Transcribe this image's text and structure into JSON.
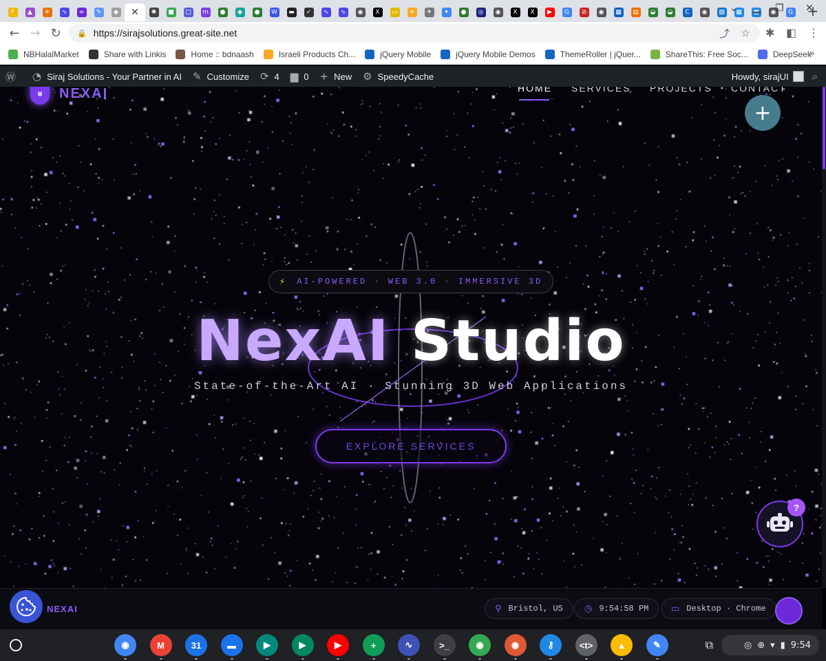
{
  "browser": {
    "url": "https://sirajsolutions.great-site.net",
    "tabs": [
      {
        "icon": "f-icon",
        "color": "#f4b400",
        "glyph": "F"
      },
      {
        "icon": "triangle-icon",
        "color": "#9c4dcc",
        "glyph": "▲"
      },
      {
        "icon": "asterisk-icon",
        "color": "#e8710a",
        "glyph": "✳"
      },
      {
        "icon": "wave-icon",
        "color": "#4f46e5",
        "glyph": "∿"
      },
      {
        "icon": "infinity-icon",
        "color": "#6d28d9",
        "glyph": "∞"
      },
      {
        "icon": "feather-icon",
        "color": "#5e97f6",
        "glyph": "✎"
      },
      {
        "icon": "cat-icon",
        "color": "#9e9e9e",
        "glyph": "◆"
      },
      {
        "icon": "openai-icon",
        "color": "#444",
        "glyph": "✺"
      },
      {
        "icon": "green-icon",
        "color": "#34a853",
        "glyph": "■"
      },
      {
        "icon": "square-icon",
        "color": "#5b5bd6",
        "glyph": "□"
      },
      {
        "icon": "m-icon",
        "color": "#7b3fe4",
        "glyph": "m"
      },
      {
        "icon": "circle-green-icon",
        "color": "#2e7d32",
        "glyph": "●"
      },
      {
        "icon": "diamond-icon",
        "color": "#1aa39a",
        "glyph": "◆"
      },
      {
        "icon": "circle-icon",
        "color": "#2e7d32",
        "glyph": "●"
      },
      {
        "icon": "wordpress-icon",
        "color": "#3858e9",
        "glyph": "W"
      },
      {
        "icon": "bar-icon",
        "color": "#222",
        "glyph": "▬"
      },
      {
        "icon": "check-icon",
        "color": "#333",
        "glyph": "✓"
      },
      {
        "icon": "wave2-icon",
        "color": "#4f46e5",
        "glyph": "∿"
      },
      {
        "icon": "wave3-icon",
        "color": "#4f46e5",
        "glyph": "∿"
      },
      {
        "icon": "globe-icon",
        "color": "#555",
        "glyph": "◉"
      },
      {
        "icon": "x-icon",
        "color": "#000",
        "glyph": "X"
      },
      {
        "icon": "doc-icon",
        "color": "#e6b800",
        "glyph": "▭"
      },
      {
        "icon": "sun-icon",
        "color": "#f9a825",
        "glyph": "☀"
      },
      {
        "icon": "bird-icon",
        "color": "#777",
        "glyph": "✈"
      },
      {
        "icon": "gemini-icon",
        "color": "#4285f4",
        "glyph": "✦"
      },
      {
        "icon": "circle-green2-icon",
        "color": "#2e7d32",
        "glyph": "●"
      },
      {
        "icon": "eye-icon",
        "color": "#1a237e",
        "glyph": "◎"
      },
      {
        "icon": "globe2-icon",
        "color": "#555",
        "glyph": "◉"
      },
      {
        "icon": "x2-icon",
        "color": "#000",
        "glyph": "X"
      },
      {
        "icon": "x3-icon",
        "color": "#000",
        "glyph": "X"
      },
      {
        "icon": "youtube-icon",
        "color": "#ff0000",
        "glyph": "▶"
      },
      {
        "icon": "google-icon",
        "color": "#4285f4",
        "glyph": "G"
      },
      {
        "icon": "no-icon",
        "color": "#c62828",
        "glyph": "⊘"
      },
      {
        "icon": "globe3-icon",
        "color": "#555",
        "glyph": "◉"
      },
      {
        "icon": "tile-icon",
        "color": "#1565c0",
        "glyph": "▦"
      },
      {
        "icon": "orange-icon",
        "color": "#ef6c00",
        "glyph": "▤"
      },
      {
        "icon": "flag-icon",
        "color": "#2e7d32",
        "glyph": "◒"
      },
      {
        "icon": "flag2-icon",
        "color": "#2e7d32",
        "glyph": "◒"
      },
      {
        "icon": "c-icon",
        "color": "#1565c0",
        "glyph": "C"
      },
      {
        "icon": "globe4-icon",
        "color": "#555",
        "glyph": "◉"
      },
      {
        "icon": "map-icon",
        "color": "#1976d2",
        "glyph": "▨"
      },
      {
        "icon": "blue-tile-icon",
        "color": "#1e88e5",
        "glyph": "▦"
      },
      {
        "icon": "blue-tile2-icon",
        "color": "#1e88e5",
        "glyph": "▦"
      },
      {
        "icon": "globe5-icon",
        "color": "#555",
        "glyph": "◉"
      },
      {
        "icon": "google2-icon",
        "color": "#4285f4",
        "glyph": "G"
      }
    ],
    "active_tab_close": "✕",
    "new_tab": "+",
    "window_controls": {
      "minimize": "▁",
      "restore": "❐",
      "close": "✕",
      "dropdown": "⌄"
    }
  },
  "bookmarks": [
    {
      "label": "NBHalalMarket",
      "color": "#4caf50"
    },
    {
      "label": "Share with Linkis",
      "color": "#333"
    },
    {
      "label": "Home :: bdnaash",
      "color": "#795548"
    },
    {
      "label": "Israeli Products Ch...",
      "color": "#f9a825"
    },
    {
      "label": "jQuery Mobile",
      "color": "#1565c0"
    },
    {
      "label": "jQuery Mobile Demos",
      "color": "#1565c0"
    },
    {
      "label": "ThemeRoller | jQuer...",
      "color": "#1565c0"
    },
    {
      "label": "ShareThis: Free Soc...",
      "color": "#7cb342"
    },
    {
      "label": "DeepSeek",
      "color": "#4f6bed"
    }
  ],
  "adminbar": {
    "site": "Siraj Solutions - Your Partner in AI",
    "customize": "Customize",
    "updates": "4",
    "comments": "0",
    "new": "New",
    "speedycache": "SpeedyCache",
    "howdy": "Howdy, sirajUI"
  },
  "site": {
    "logo_text": "NEXAI",
    "nav": [
      "HOME",
      "SERVICES",
      "PROJECTS",
      "CONTACT"
    ],
    "badge": "AI-POWERED · WEB 3.0 · IMMERSIVE 3D",
    "title_part1": "NexAI",
    "title_part2": "Studio",
    "subtitle": "State-of-the-Art AI · Stunning 3D Web Applications",
    "cta": "EXPLORE SERVICES",
    "help_badge": "?",
    "footer": {
      "logo": "NEXAI",
      "location": "Bristol, US",
      "time": "9:54:58 PM",
      "device": "Desktop · Chrome"
    },
    "colors": {
      "accent": "#8b5cf6",
      "accent_dark": "#7c3aed",
      "fab": "#467c8d"
    }
  },
  "shelf": {
    "apps": [
      {
        "name": "chrome-app",
        "color": "#4285f4",
        "glyph": "◉"
      },
      {
        "name": "gmail-app",
        "color": "#ea4335",
        "glyph": "M"
      },
      {
        "name": "calendar-app",
        "color": "#1a73e8",
        "glyph": "31"
      },
      {
        "name": "files-app",
        "color": "#1a73e8",
        "glyph": "▬"
      },
      {
        "name": "meet-app",
        "color": "#00897b",
        "glyph": "▶"
      },
      {
        "name": "play-store-app",
        "color": "#01875f",
        "glyph": "▶"
      },
      {
        "name": "youtube-app",
        "color": "#ff0000",
        "glyph": "▶"
      },
      {
        "name": "sheets-app",
        "color": "#0f9d58",
        "glyph": "+"
      },
      {
        "name": "wave-app",
        "color": "#3f51b5",
        "glyph": "∿"
      },
      {
        "name": "terminal-app",
        "color": "#3c4043",
        "glyph": ">_"
      },
      {
        "name": "maps-app",
        "color": "#34a853",
        "glyph": "◉"
      },
      {
        "name": "duckduckgo-app",
        "color": "#de5833",
        "glyph": "◉"
      },
      {
        "name": "keys-app",
        "color": "#1e88e5",
        "glyph": "⚷"
      },
      {
        "name": "text-app",
        "color": "#5f6368",
        "glyph": "<t>"
      },
      {
        "name": "drive-app",
        "color": "#fbbc04",
        "glyph": "▲"
      },
      {
        "name": "pen-app",
        "color": "#4285f4",
        "glyph": "✎"
      }
    ],
    "time": "9:54"
  }
}
